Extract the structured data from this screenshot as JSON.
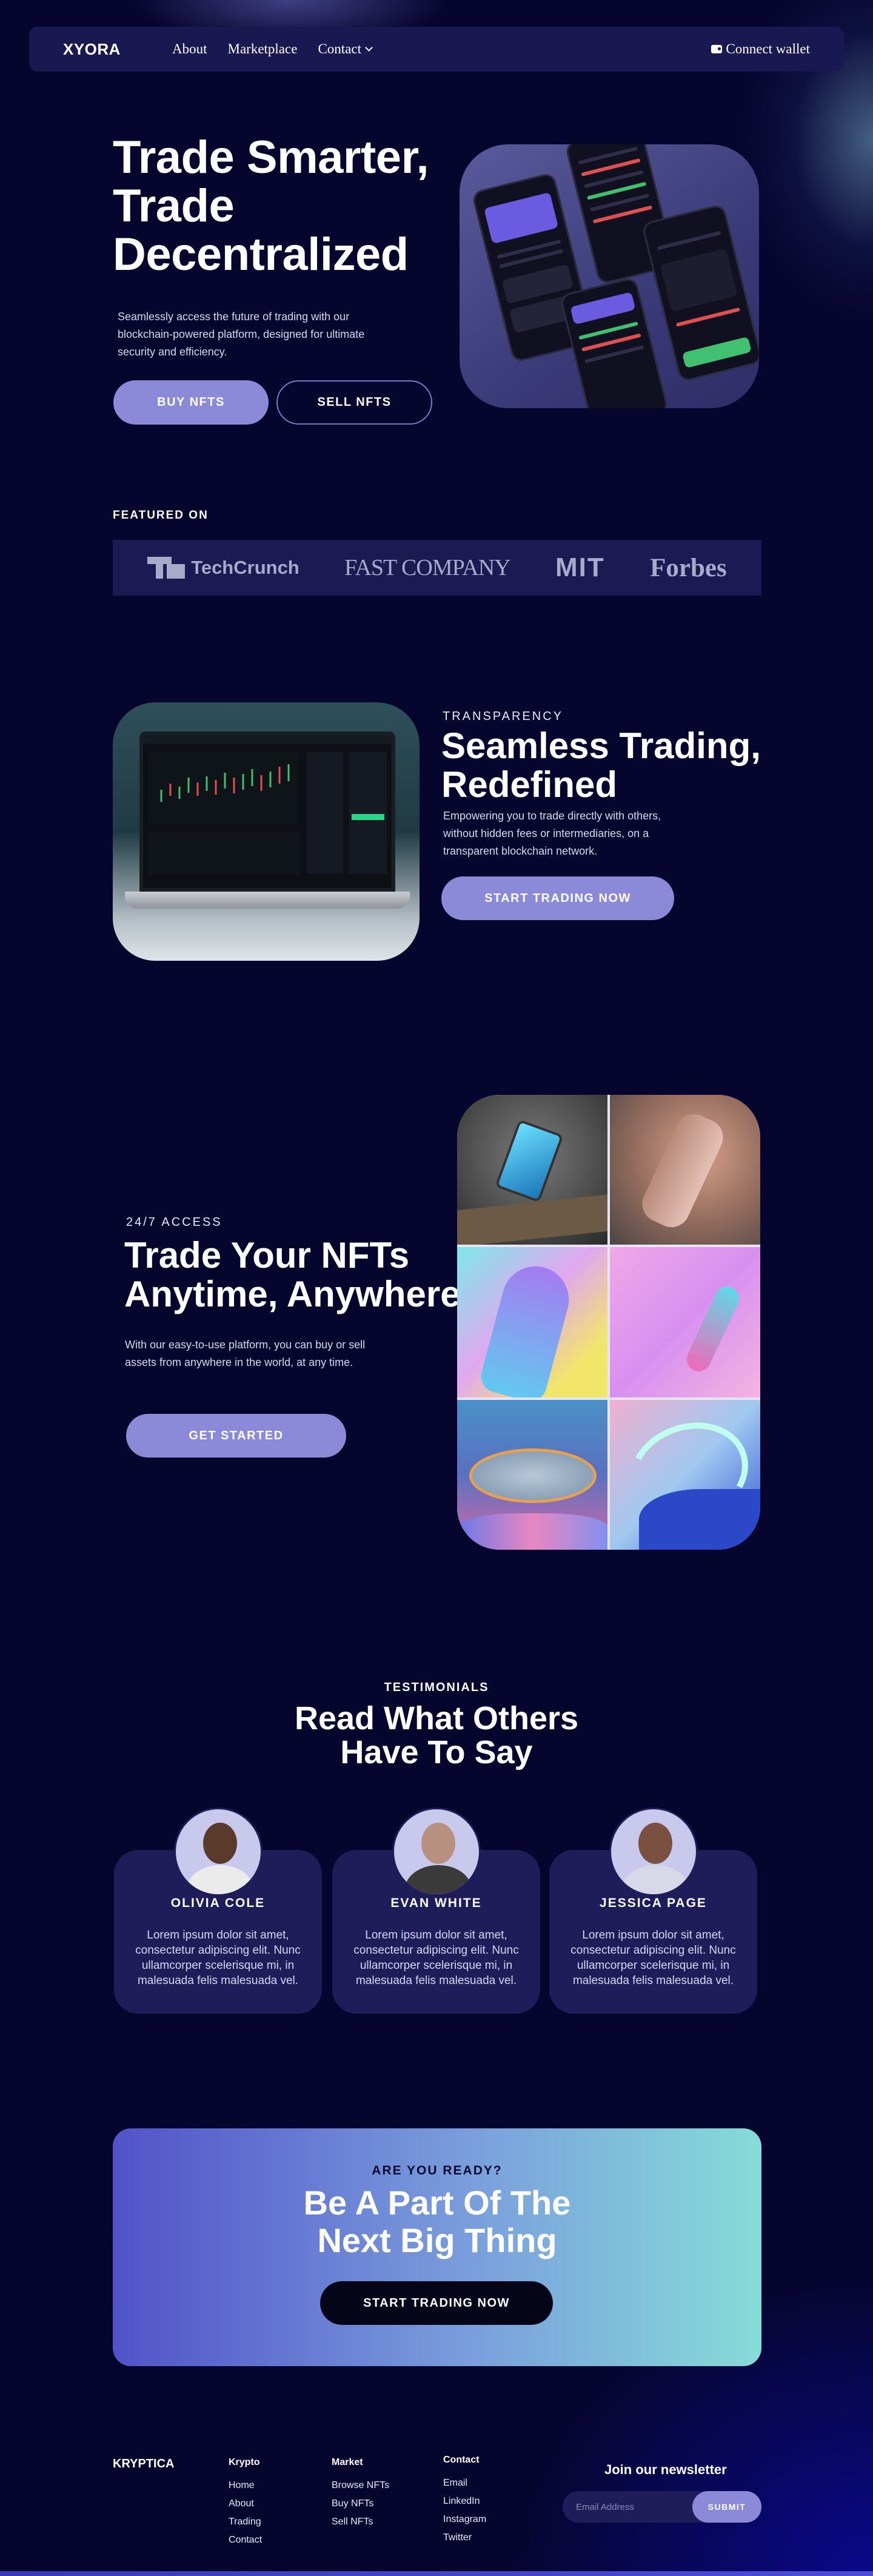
{
  "nav": {
    "logo": "XYORA",
    "links": [
      "About",
      "Marketplace",
      "Contact"
    ],
    "wallet_label": "Connect wallet"
  },
  "hero": {
    "title_line1": "Trade Smarter,",
    "title_line2": "Trade",
    "title_line3": "Decentralized",
    "description": "Seamlessly access the future of trading with our blockchain-powered platform, designed for ultimate security and efficiency.",
    "buy_label": "BUY NFTS",
    "sell_label": "SELL NFTS"
  },
  "featured": {
    "label": "FEATURED ON",
    "brands": [
      "TechCrunch",
      "FAST COMPANY",
      "MIT",
      "Forbes"
    ]
  },
  "transparency": {
    "eyebrow": "TRANSPARENCY",
    "title_line1": "Seamless Trading,",
    "title_line2": "Redefined",
    "description": "Empowering you to trade directly with others, without hidden fees or intermediaries, on a transparent blockchain network.",
    "cta_label": "START TRADING NOW"
  },
  "access": {
    "eyebrow": "24/7 ACCESS",
    "title_line1": "Trade Your NFTs",
    "title_line2": "Anytime, Anywhere",
    "description": "With our easy-to-use platform, you can buy or sell assets from anywhere in the world, at any time.",
    "cta_label": "GET STARTED"
  },
  "testimonials": {
    "eyebrow": "TESTIMONIALS",
    "title_line1": "Read What Others",
    "title_line2": "Have To Say",
    "cards": [
      {
        "name": "OLIVIA COLE",
        "text": "Lorem ipsum dolor sit amet, consectetur adipiscing elit. Nunc ullamcorper scelerisque mi, in malesuada felis malesuada vel."
      },
      {
        "name": "EVAN WHITE",
        "text": "Lorem ipsum dolor sit amet, consectetur adipiscing elit. Nunc ullamcorper scelerisque mi, in malesuada felis malesuada vel."
      },
      {
        "name": "JESSICA PAGE",
        "text": "Lorem ipsum dolor sit amet, consectetur adipiscing elit. Nunc ullamcorper scelerisque mi, in malesuada felis malesuada vel."
      }
    ]
  },
  "cta": {
    "eyebrow": "ARE YOU READY?",
    "title_line1": "Be A Part Of The",
    "title_line2": "Next Big Thing",
    "button_label": "START TRADING NOW"
  },
  "footer": {
    "logo": "KRYPTICA",
    "columns": [
      {
        "heading": "Krypto",
        "items": [
          "Home",
          "About",
          "Trading",
          "Contact"
        ]
      },
      {
        "heading": "Market",
        "items": [
          "Browse NFTs",
          "Buy NFTs",
          "Sell NFTs"
        ]
      },
      {
        "heading": "Contact",
        "items": [
          "Email",
          "LinkedIn",
          "Instagram",
          "Twitter"
        ]
      }
    ],
    "newsletter_title": "Join our newsletter",
    "newsletter_placeholder": "Email Address",
    "newsletter_button": "SUBMIT"
  },
  "colors": {
    "background": "#06052e",
    "accent": "#8c8ad8",
    "card": "#1f1c5a",
    "nav": "#1a1850"
  }
}
